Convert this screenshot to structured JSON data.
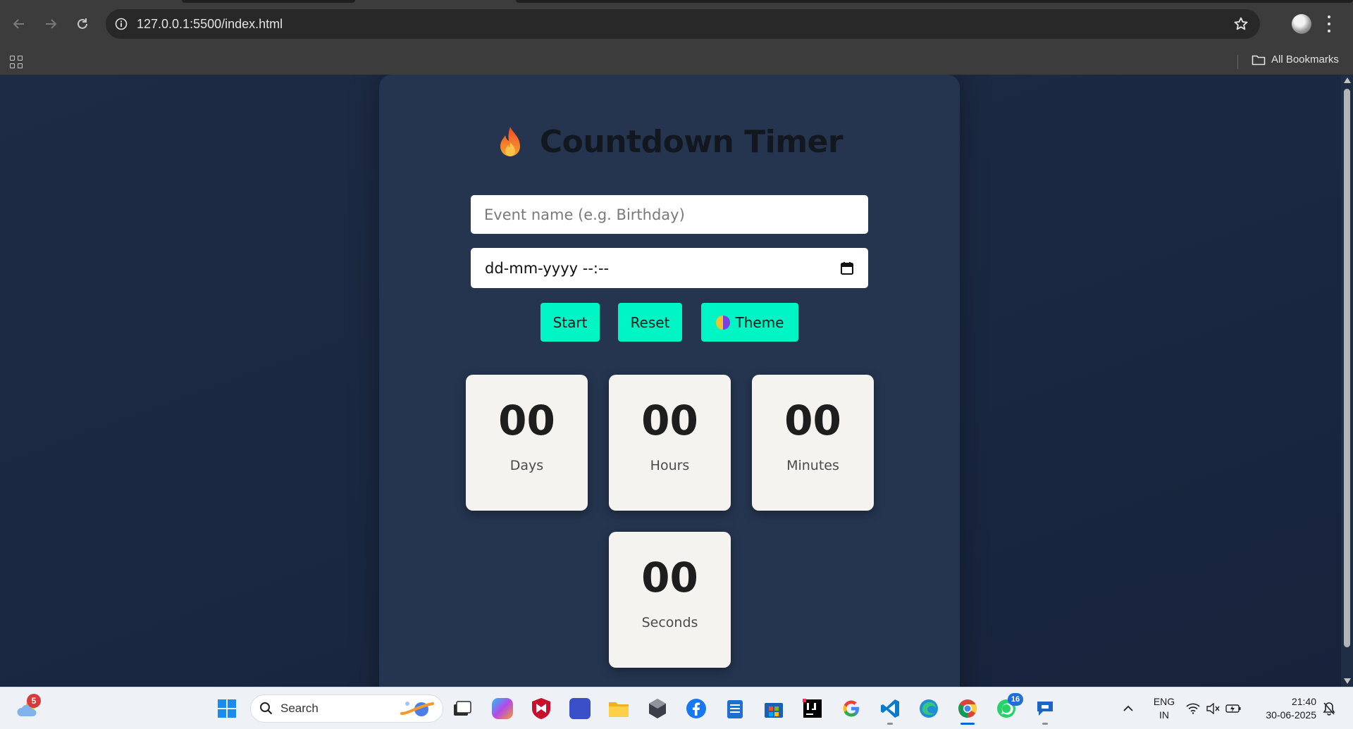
{
  "browser": {
    "url": "127.0.0.1:5500/index.html",
    "bookmarks_label": "All Bookmarks"
  },
  "app": {
    "title": "Countdown Timer",
    "title_icon": "flame-icon",
    "event_placeholder": "Event name (e.g. Birthday)",
    "datetime_placeholder": "dd-mm-yyyy --:--",
    "buttons": {
      "start": "Start",
      "reset": "Reset",
      "theme": "Theme"
    },
    "countdown": {
      "days": {
        "value": "00",
        "label": "Days"
      },
      "hours": {
        "value": "00",
        "label": "Hours"
      },
      "minutes": {
        "value": "00",
        "label": "Minutes"
      },
      "seconds": {
        "value": "00",
        "label": "Seconds"
      }
    },
    "colors": {
      "accent": "#00f5c4",
      "card": "#253550",
      "background": "#1c2a42",
      "box": "#f4f3ef"
    }
  },
  "taskbar": {
    "weather_badge": "5",
    "search_placeholder": "Search",
    "whatsapp_badge": "16",
    "language": "ENG",
    "region": "IN",
    "time": "21:40",
    "date": "30-06-2025"
  }
}
